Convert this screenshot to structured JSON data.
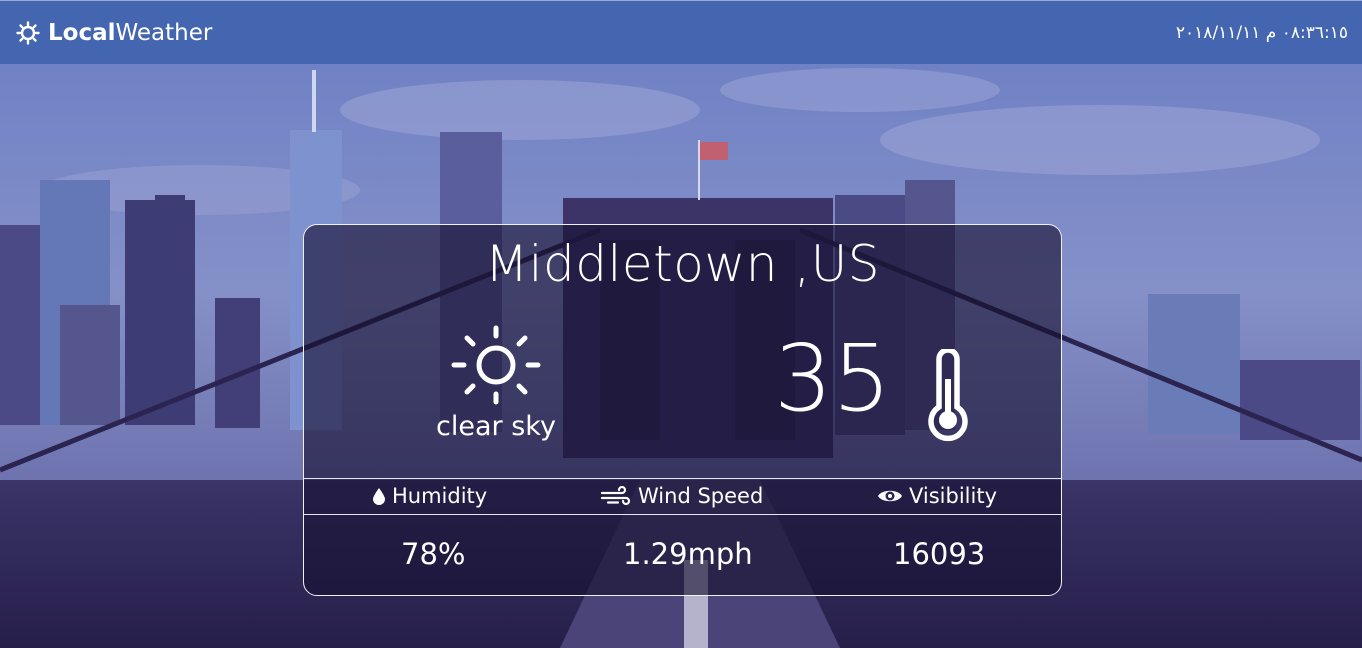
{
  "header": {
    "brand_bold": "Local",
    "brand_light": "Weather",
    "datetime": "٠٨:٣٦:١٥ م ٢٠١٨/١١/١١"
  },
  "weather": {
    "location": "Middletown ,US",
    "condition": "clear sky",
    "condition_icon": "sun-icon",
    "temperature": "35",
    "temperature_icon": "thermometer-icon"
  },
  "stats": {
    "humidity": {
      "label": "Humidity",
      "value": "78%",
      "icon": "droplet-icon"
    },
    "wind": {
      "label": "Wind Speed",
      "value": "1.29mph",
      "icon": "wind-icon"
    },
    "visibility": {
      "label": "Visibility",
      "value": "16093",
      "icon": "eye-icon"
    }
  },
  "colors": {
    "navbar": "#4466b0",
    "overlay": "#3a3470",
    "text": "#ffffff"
  }
}
